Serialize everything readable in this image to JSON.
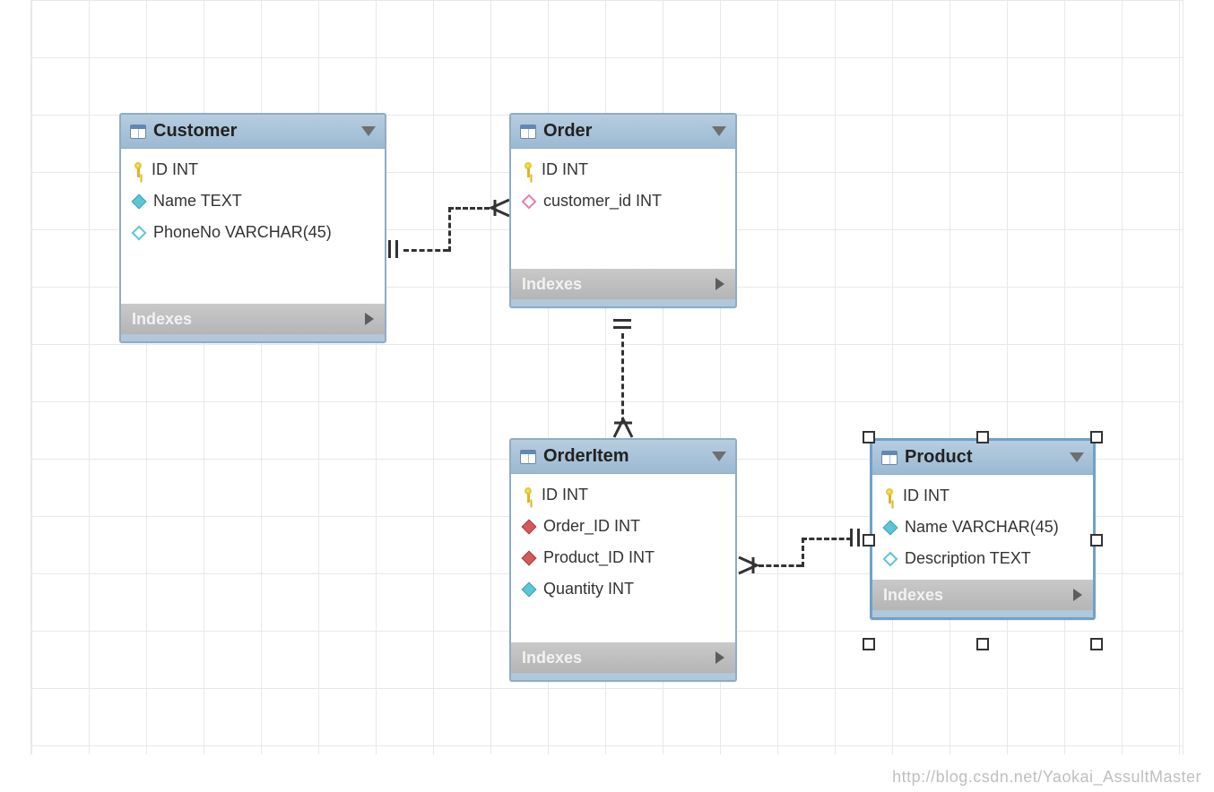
{
  "watermark": "http://blog.csdn.net/Yaokai_AssultMaster",
  "indexes_label": "Indexes",
  "entities": {
    "customer": {
      "title": "Customer",
      "columns": [
        {
          "icon": "key",
          "text": "ID INT"
        },
        {
          "icon": "cyan-filled",
          "text": "Name TEXT"
        },
        {
          "icon": "cyan-hollow",
          "text": "PhoneNo VARCHAR(45)"
        }
      ]
    },
    "order": {
      "title": "Order",
      "columns": [
        {
          "icon": "key",
          "text": "ID INT"
        },
        {
          "icon": "pink-hollow",
          "text": "customer_id INT"
        }
      ]
    },
    "orderitem": {
      "title": "OrderItem",
      "columns": [
        {
          "icon": "key",
          "text": "ID INT"
        },
        {
          "icon": "red-filled",
          "text": "Order_ID INT"
        },
        {
          "icon": "red-filled",
          "text": "Product_ID INT"
        },
        {
          "icon": "cyan-filled",
          "text": "Quantity INT"
        }
      ]
    },
    "product": {
      "title": "Product",
      "columns": [
        {
          "icon": "key",
          "text": "ID INT"
        },
        {
          "icon": "cyan-filled",
          "text": "Name VARCHAR(45)"
        },
        {
          "icon": "cyan-hollow",
          "text": "Description TEXT"
        }
      ]
    }
  },
  "relationships": [
    {
      "from": "Customer",
      "to": "Order",
      "type": "one-to-many"
    },
    {
      "from": "Order",
      "to": "OrderItem",
      "type": "one-to-many"
    },
    {
      "from": "Product",
      "to": "OrderItem",
      "type": "one-to-many"
    }
  ]
}
